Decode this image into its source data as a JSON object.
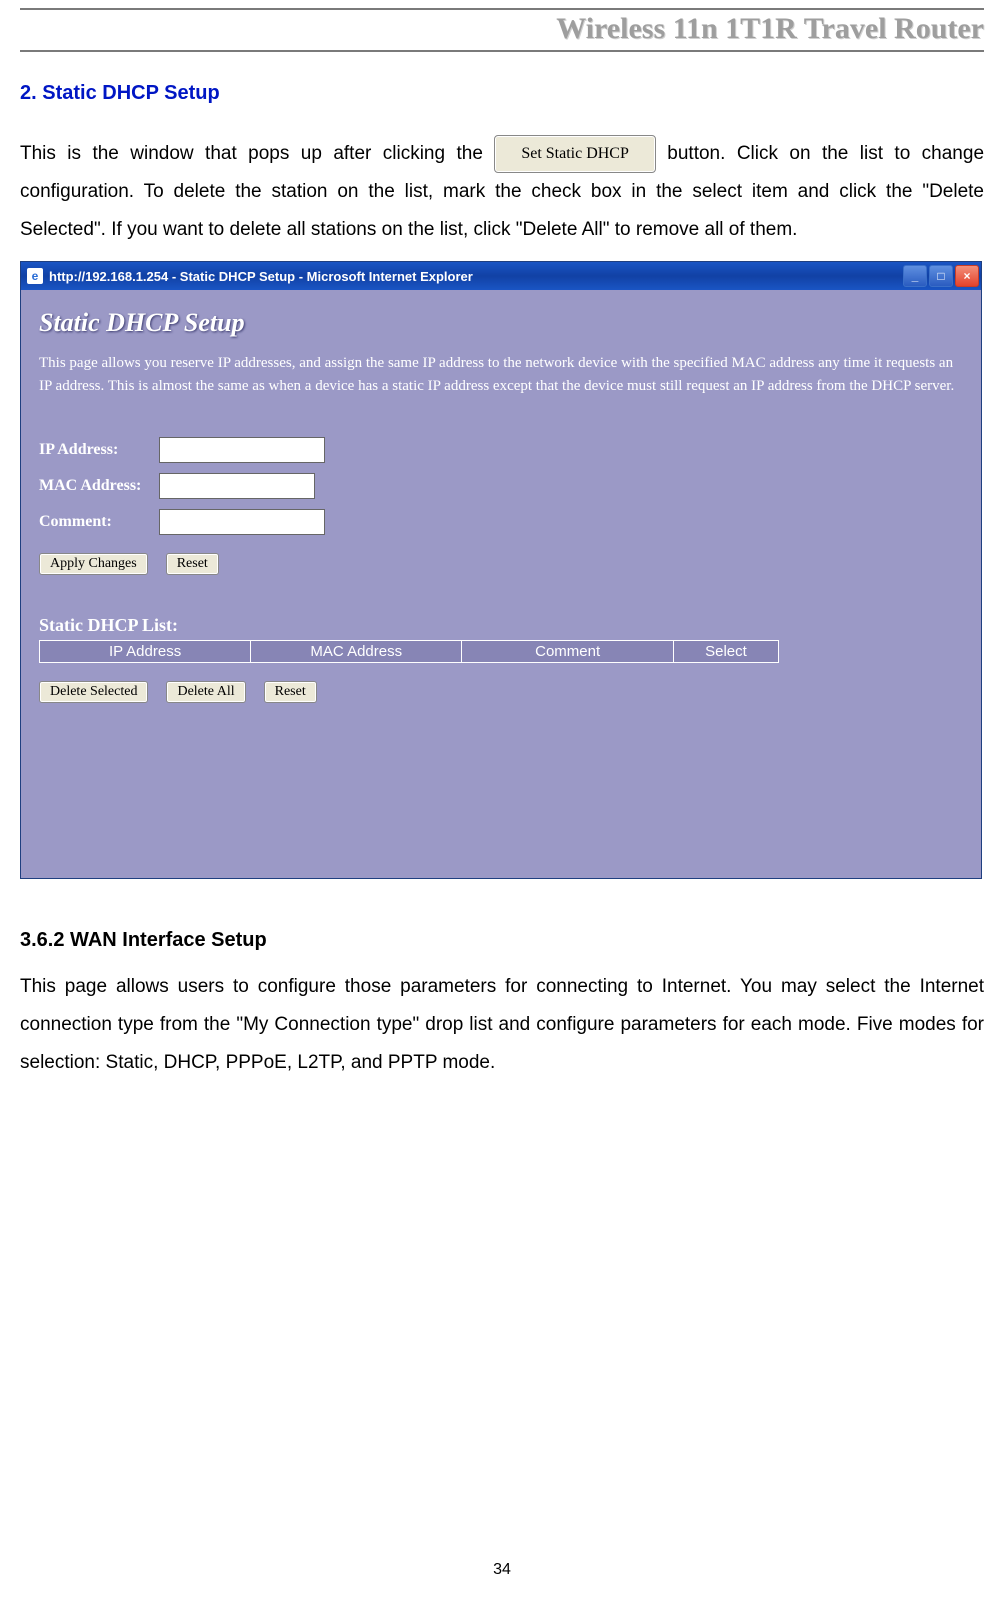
{
  "header": {
    "title": "Wireless 11n 1T1R Travel Router"
  },
  "section1": {
    "heading": "2. Static DHCP Setup",
    "para_pre": "This is the window that pops up after clicking the ",
    "inline_button_label": "Set Static DHCP",
    "para_post": " button. Click on the list to change configuration. To delete the station on the list, mark the check box in the select item and click the \"Delete Selected\". If you want to delete all stations on the list, click \"Delete All\" to remove all of them."
  },
  "ie_window": {
    "titlebar_text": "http://192.168.1.254 - Static DHCP Setup - Microsoft Internet Explorer",
    "icon_glyph": "e",
    "page_title": "Static DHCP Setup",
    "page_desc": "This page allows you reserve IP addresses, and assign the same IP address to the network device with the specified MAC address any time it requests an IP address. This is almost the same as when a device has a static IP address except that the device must still request an IP address from the DHCP server.",
    "form": {
      "ip_label": "IP Address:",
      "mac_label": "MAC Address:",
      "comment_label": "Comment:"
    },
    "buttons": {
      "apply": "Apply Changes",
      "reset1": "Reset",
      "delete_selected": "Delete Selected",
      "delete_all": "Delete All",
      "reset2": "Reset"
    },
    "list": {
      "title": "Static DHCP List:",
      "col_ip": "IP Address",
      "col_mac": "MAC Address",
      "col_comment": "Comment",
      "col_select": "Select"
    }
  },
  "section2": {
    "heading": "3.6.2   WAN Interface Setup",
    "para": "This page allows users to configure those parameters for connecting to Internet. You may select the Internet connection type from the \"My Connection type\" drop list and configure parameters for each mode. Five modes for selection: Static, DHCP, PPPoE, L2TP, and PPTP mode."
  },
  "page_number": "34"
}
